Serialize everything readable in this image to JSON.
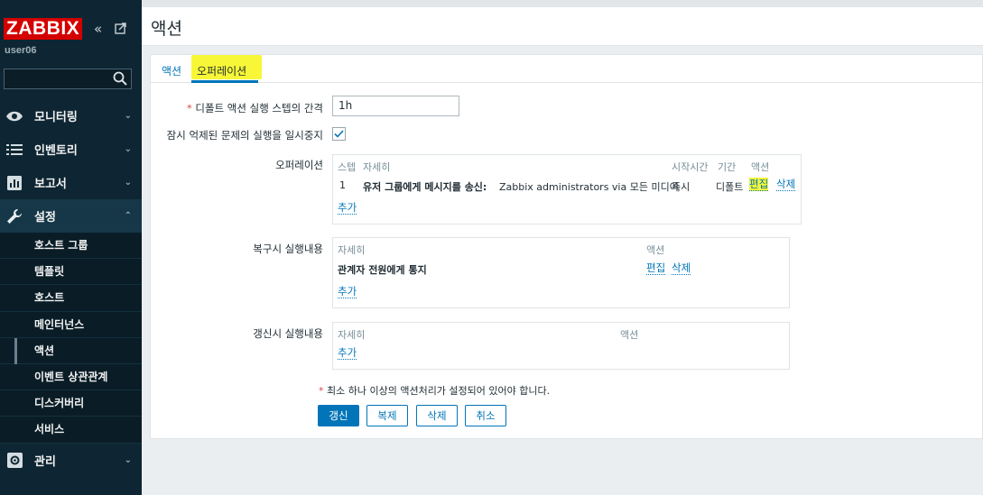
{
  "sidebar": {
    "logo": "ZABBIX",
    "username": "user06",
    "search": {
      "value": "",
      "placeholder": ""
    },
    "menu": [
      {
        "label": "모니터링",
        "icon": "eye-icon"
      },
      {
        "label": "인벤토리",
        "icon": "list-icon"
      },
      {
        "label": "보고서",
        "icon": "report-icon"
      },
      {
        "label": "설정",
        "icon": "wrench-icon"
      }
    ],
    "submenu": [
      "호스트 그룹",
      "템플릿",
      "호스트",
      "메인터넌스",
      "액션",
      "이벤트 상관관계",
      "디스커버리",
      "서비스"
    ],
    "manage": "관리"
  },
  "header": {
    "title": "액션"
  },
  "tabs": [
    {
      "label": "액션"
    },
    {
      "label": "오퍼레이션"
    }
  ],
  "form": {
    "default_step_label": "디폴트 액션 실행 스텝의 간격",
    "default_step_value": "1h",
    "pause_label": "잠시 억제된 문제의 실행을 일시중지",
    "pause_checked": true,
    "operations": {
      "label": "오퍼레이션",
      "headers": {
        "step": "스텝",
        "detail": "자세히",
        "start": "시작시간",
        "duration": "기간",
        "action": "액션"
      },
      "rows": [
        {
          "step": "1",
          "detail_prefix": "유저 그룹에게 메시지를 송신:",
          "detail_rest": "Zabbix administrators via 모든 미디어",
          "start": "즉시",
          "duration": "디폴트",
          "edit": "편집",
          "delete": "삭제"
        }
      ],
      "add": "추가"
    },
    "recovery": {
      "label": "복구시 실행내용",
      "headers": {
        "detail": "자세히",
        "action": "액션"
      },
      "rows": [
        {
          "detail": "관계자 전원에게 통지",
          "edit": "편집",
          "delete": "삭제"
        }
      ],
      "add": "추가"
    },
    "update": {
      "label": "갱신시 실행내용",
      "headers": {
        "detail": "자세히",
        "action": "액션"
      },
      "add": "추가"
    },
    "note": "최소 하나 이상의 액션처리가 설정되어 있어야 합니다.",
    "buttons": {
      "update": "갱신",
      "clone": "복제",
      "delete": "삭제",
      "cancel": "취소"
    }
  }
}
